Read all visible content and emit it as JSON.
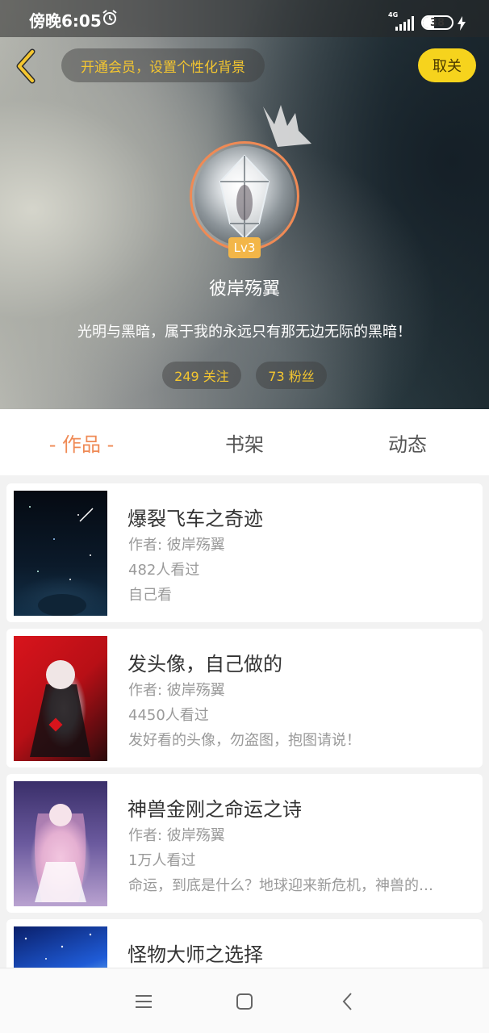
{
  "status_bar": {
    "time": "傍晚6:05",
    "network": "4G",
    "battery": "38",
    "battery_level": 0.38
  },
  "header": {
    "vip_prompt": "开通会员，设置个性化背景",
    "follow_button": "取关",
    "level": "Lv3",
    "username": "彼岸殇翼",
    "bio": "光明与黑暗，属于我的永远只有那无边无际的黑暗！",
    "following": "249 关注",
    "followers": "73 粉丝",
    "accent_color": "#f4c630"
  },
  "tabs": [
    {
      "label": "- 作品 -",
      "active": true
    },
    {
      "label": "书架",
      "active": false
    },
    {
      "label": "动态",
      "active": false
    }
  ],
  "works": [
    {
      "title": "爆裂飞车之奇迹",
      "author": "作者: 彼岸殇翼",
      "views": "482人看过",
      "summary": "自己看"
    },
    {
      "title": "发头像，自己做的",
      "author": "作者: 彼岸殇翼",
      "views": "4450人看过",
      "summary": "发好看的头像，勿盗图，抱图请说！"
    },
    {
      "title": "神兽金刚之命运之诗",
      "author": "作者: 彼岸殇翼",
      "views": "1万人看过",
      "summary": "命运，到底是什么？地球迎来新危机，神兽的…"
    },
    {
      "title": "怪物大师之选择",
      "author": "",
      "views": "",
      "summary": ""
    }
  ],
  "icons": {
    "back": "chevron-left-icon",
    "alarm": "alarm-clock-icon",
    "menu": "menu-icon",
    "home": "home-square-icon",
    "nav_back": "back-triangle-icon"
  }
}
